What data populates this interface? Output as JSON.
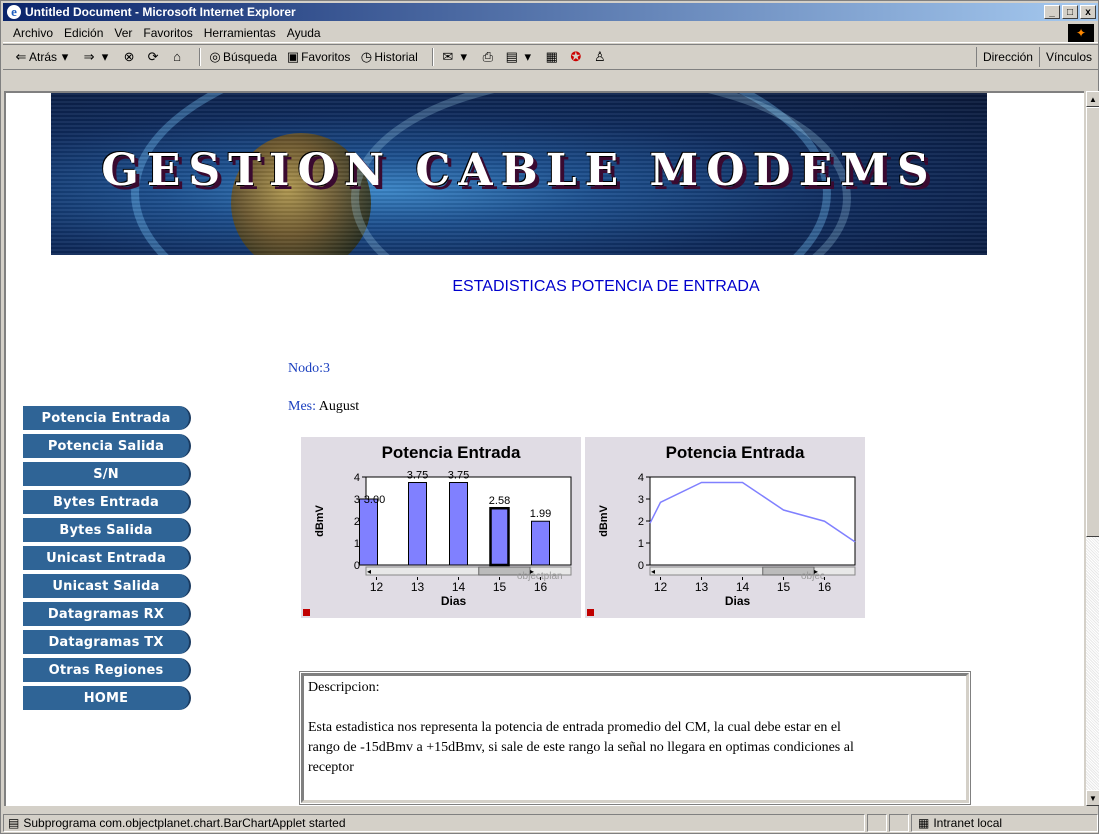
{
  "window": {
    "title": "Untitled Document - Microsoft Internet Explorer",
    "min_label": "_",
    "max_label": "□",
    "close_label": "x"
  },
  "menu": [
    "Archivo",
    "Edición",
    "Ver",
    "Favoritos",
    "Herramientas",
    "Ayuda"
  ],
  "toolbar": {
    "back": "Atrás",
    "search": "Búsqueda",
    "favorites": "Favoritos",
    "history": "Historial",
    "address": "Dirección",
    "links": "Vínculos"
  },
  "banner": {
    "title": "GESTION CABLE MODEMS"
  },
  "page": {
    "heading": "ESTADISTICAS POTENCIA DE ENTRADA",
    "node_label": "Nodo:",
    "node_value": "3",
    "month_label": "Mes:",
    "month_value": "August"
  },
  "sidebar": {
    "items": [
      "Potencia Entrada",
      "Potencia Salida",
      "S/N",
      "Bytes Entrada",
      "Bytes Salida",
      "Unicast Entrada",
      "Unicast Salida",
      "Datagramas RX",
      "Datagramas TX",
      "Otras Regiones",
      "HOME"
    ]
  },
  "chart_data": [
    {
      "type": "bar",
      "title": "Potencia Entrada",
      "xlabel": "Dias",
      "ylabel": "dBmV",
      "categories": [
        "12",
        "13",
        "14",
        "15",
        "16"
      ],
      "values": [
        3.0,
        3.75,
        3.75,
        2.58,
        1.99
      ],
      "value_labels": [
        "3.00",
        "3.75",
        "3.75",
        "2.58",
        "1.99"
      ],
      "yticks": [
        "0",
        "1",
        "2",
        "3",
        "4"
      ],
      "ylim": [
        0,
        4
      ],
      "watermark": "objectplan",
      "bar_color": "#8080ff"
    },
    {
      "type": "line",
      "title": "Potencia Entrada",
      "xlabel": "Dias",
      "ylabel": "dBmV",
      "categories": [
        "12",
        "13",
        "14",
        "15",
        "16"
      ],
      "values": [
        2.85,
        3.75,
        3.75,
        2.5,
        1.99
      ],
      "line_start": 1.9,
      "line_end": 1.05,
      "yticks": [
        "0",
        "1",
        "2",
        "3",
        "4"
      ],
      "ylim": [
        0,
        4
      ],
      "watermark": "objec",
      "line_color": "#8080ff"
    }
  ],
  "description": {
    "title": "Descripcion:",
    "text": "Esta estadistica nos representa la potencia de entrada promedio del CM, la cual debe estar en el rango de -15dBmv a +15dBmv, si sale de este rango la señal no llegara en optimas condiciones al receptor"
  },
  "status": {
    "text": "Subprograma com.objectplanet.chart.BarChartApplet started",
    "zone": "Intranet local"
  }
}
